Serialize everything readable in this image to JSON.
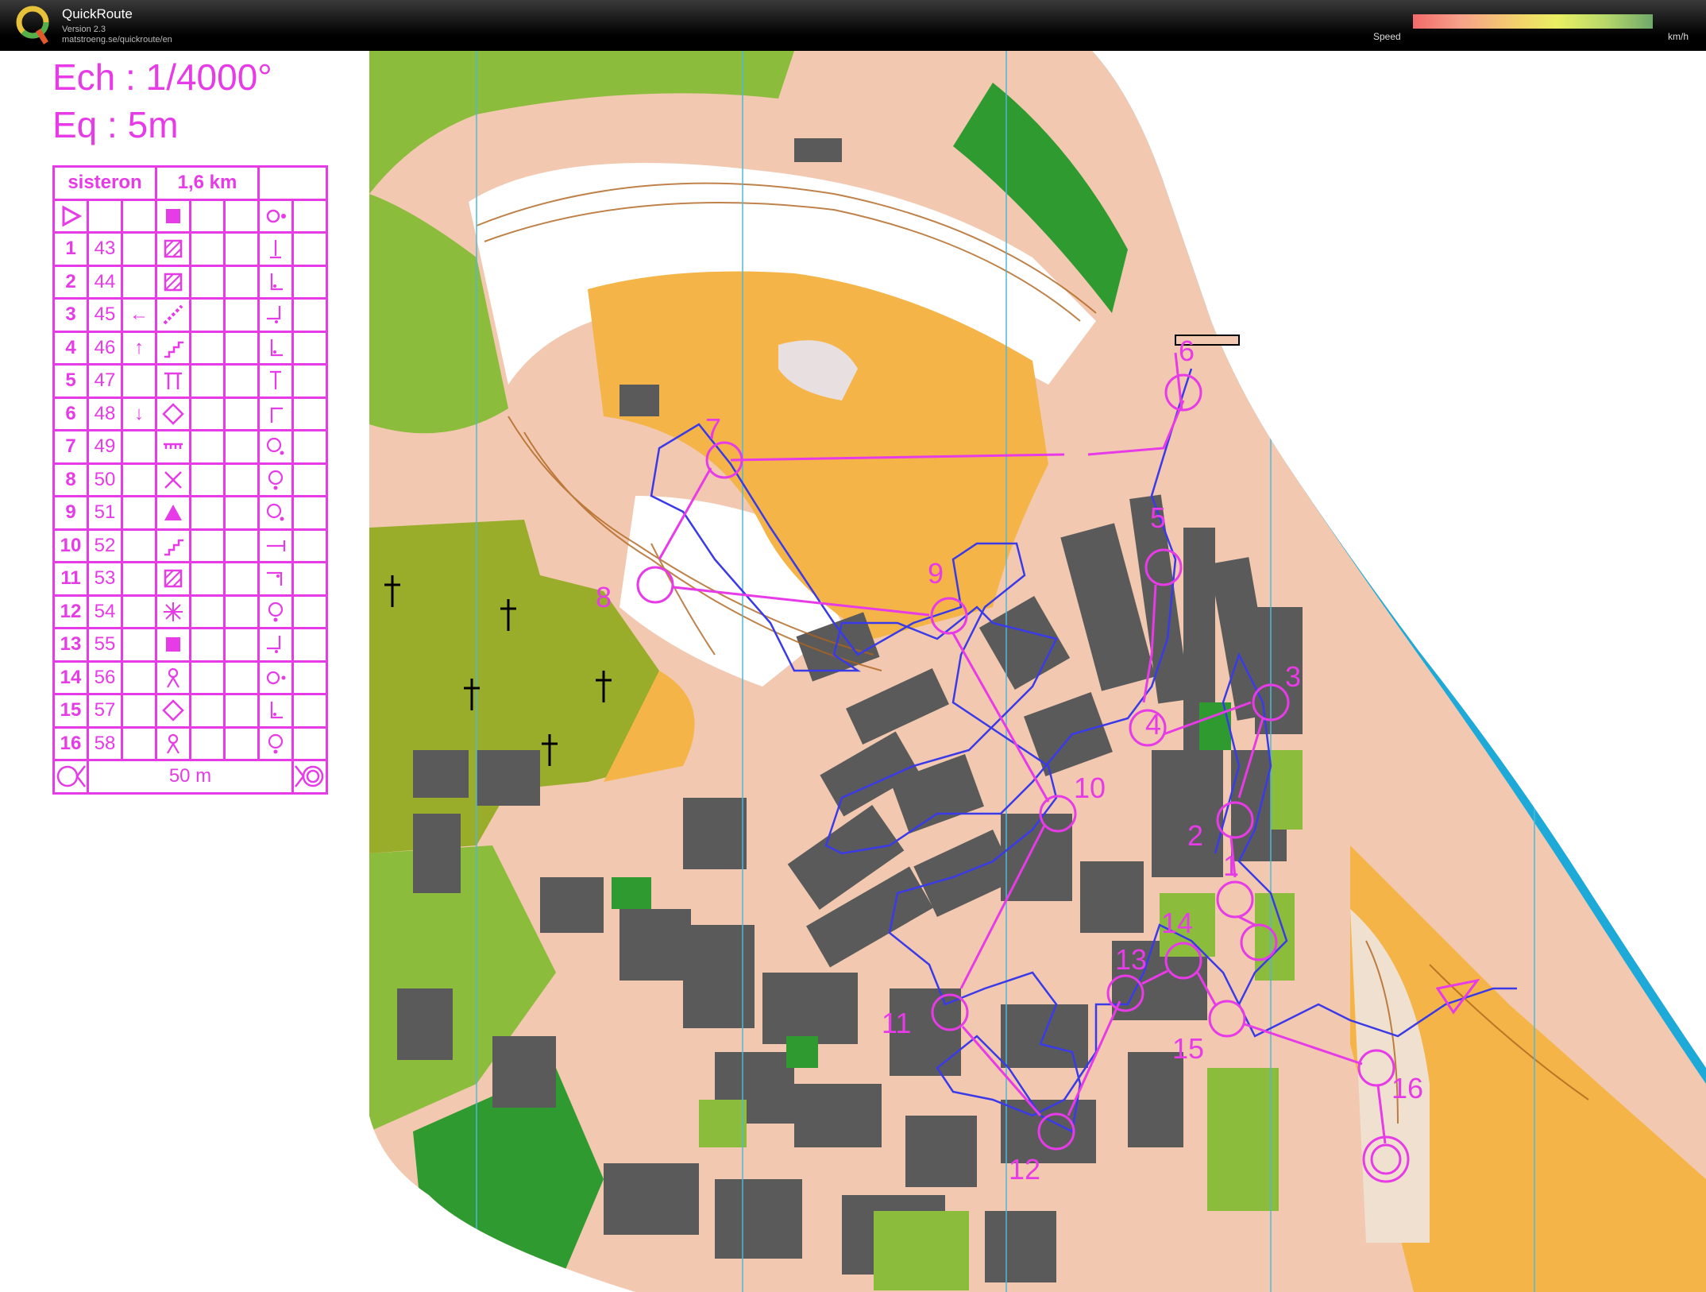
{
  "app": {
    "name": "QuickRoute",
    "version": "Version 2.3",
    "url": "matstroeng.se/quickroute/en",
    "speed_label": "Speed",
    "speed_unit": "km/h"
  },
  "legend": {
    "scale": "Ech : 1/4000°",
    "equidistance": "Eq : 5m",
    "event_name": "sisteron",
    "course_length": "1,6 km",
    "finish_distance": "50 m",
    "controls": [
      {
        "num": "1",
        "code": "43",
        "dir": "",
        "feature": "hatched-square",
        "loc": "foot-marker"
      },
      {
        "num": "2",
        "code": "44",
        "dir": "",
        "feature": "hatched-square",
        "loc": "corner-inside"
      },
      {
        "num": "3",
        "code": "45",
        "dir": "←",
        "feature": "diagonal-steps",
        "loc": "corner-right"
      },
      {
        "num": "4",
        "code": "46",
        "dir": "↑",
        "feature": "stairs",
        "loc": "corner-inside"
      },
      {
        "num": "5",
        "code": "47",
        "dir": "",
        "feature": "gate",
        "loc": "top-marker"
      },
      {
        "num": "6",
        "code": "48",
        "dir": "↓",
        "feature": "diamond",
        "loc": "corner-outside"
      },
      {
        "num": "7",
        "code": "49",
        "dir": "",
        "feature": "wall-end",
        "loc": "circle-se"
      },
      {
        "num": "8",
        "code": "50",
        "dir": "",
        "feature": "cross",
        "loc": "circle-s"
      },
      {
        "num": "9",
        "code": "51",
        "dir": "",
        "feature": "triangle",
        "loc": "circle-se"
      },
      {
        "num": "10",
        "code": "52",
        "dir": "",
        "feature": "stairs",
        "loc": "side-end"
      },
      {
        "num": "11",
        "code": "53",
        "dir": "",
        "feature": "hatched-square",
        "loc": "corner-right2"
      },
      {
        "num": "12",
        "code": "54",
        "dir": "",
        "feature": "star-grid",
        "loc": "circle-s"
      },
      {
        "num": "13",
        "code": "55",
        "dir": "",
        "feature": "filled-square",
        "loc": "corner-right"
      },
      {
        "num": "14",
        "code": "56",
        "dir": "",
        "feature": "person",
        "loc": "circle-e"
      },
      {
        "num": "15",
        "code": "57",
        "dir": "",
        "feature": "diamond",
        "loc": "corner-inside"
      },
      {
        "num": "16",
        "code": "58",
        "dir": "",
        "feature": "person",
        "loc": "circle-s"
      }
    ]
  },
  "map": {
    "control_labels": [
      "1",
      "2",
      "3",
      "4",
      "5",
      "6",
      "7",
      "8",
      "9",
      "10",
      "11",
      "12",
      "13",
      "14",
      "15",
      "16"
    ],
    "colors": {
      "course": "#e63be6",
      "route": "#3a3ae8",
      "water": "#1eaad8",
      "building": "#5a5a5a",
      "paved": "#f2c9b0",
      "open": "#f4b448",
      "forest": "#8cbc3c",
      "dense": "#2f9a2f",
      "olive": "#9aad2a"
    }
  }
}
